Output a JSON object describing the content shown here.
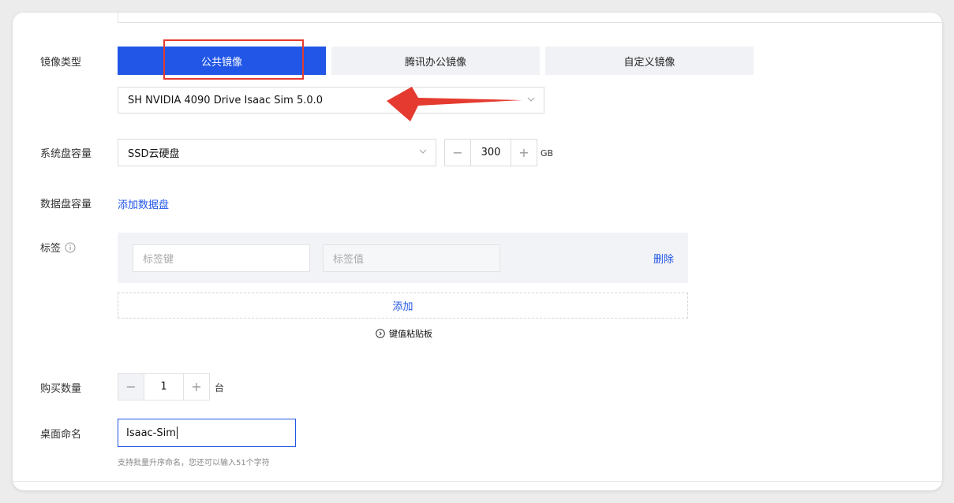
{
  "form": {
    "image_type": {
      "label": "镜像类型",
      "tabs": [
        {
          "label": "公共镜像",
          "active": true
        },
        {
          "label": "腾讯办公镜像",
          "active": false
        },
        {
          "label": "自定义镜像",
          "active": false
        }
      ],
      "selected_image": "SH NVIDIA 4090 Drive Isaac Sim 5.0.0"
    },
    "system_disk": {
      "label": "系统盘容量",
      "type_value": "SSD云硬盘",
      "size": "300",
      "unit": "GB"
    },
    "data_disk": {
      "label": "数据盘容量",
      "add_link": "添加数据盘"
    },
    "tags": {
      "label": "标签",
      "key_placeholder": "标签键",
      "value_placeholder": "标签值",
      "delete_label": "删除",
      "add_label": "添加",
      "clipboard_label": "键值粘贴板"
    },
    "quantity": {
      "label": "购买数量",
      "value": "1",
      "unit": "台"
    },
    "desktop_name": {
      "label": "桌面命名",
      "value": "Isaac-Sim",
      "hint": "支持批量升序命名，您还可以输入51个字符"
    }
  },
  "colors": {
    "accent": "#2156e6",
    "annotation_red": "#e53a2f"
  },
  "icons": {
    "chevron": "chevron-down-icon",
    "info": "info-circle-icon",
    "clipboard": "chevron-right-circle-icon"
  }
}
